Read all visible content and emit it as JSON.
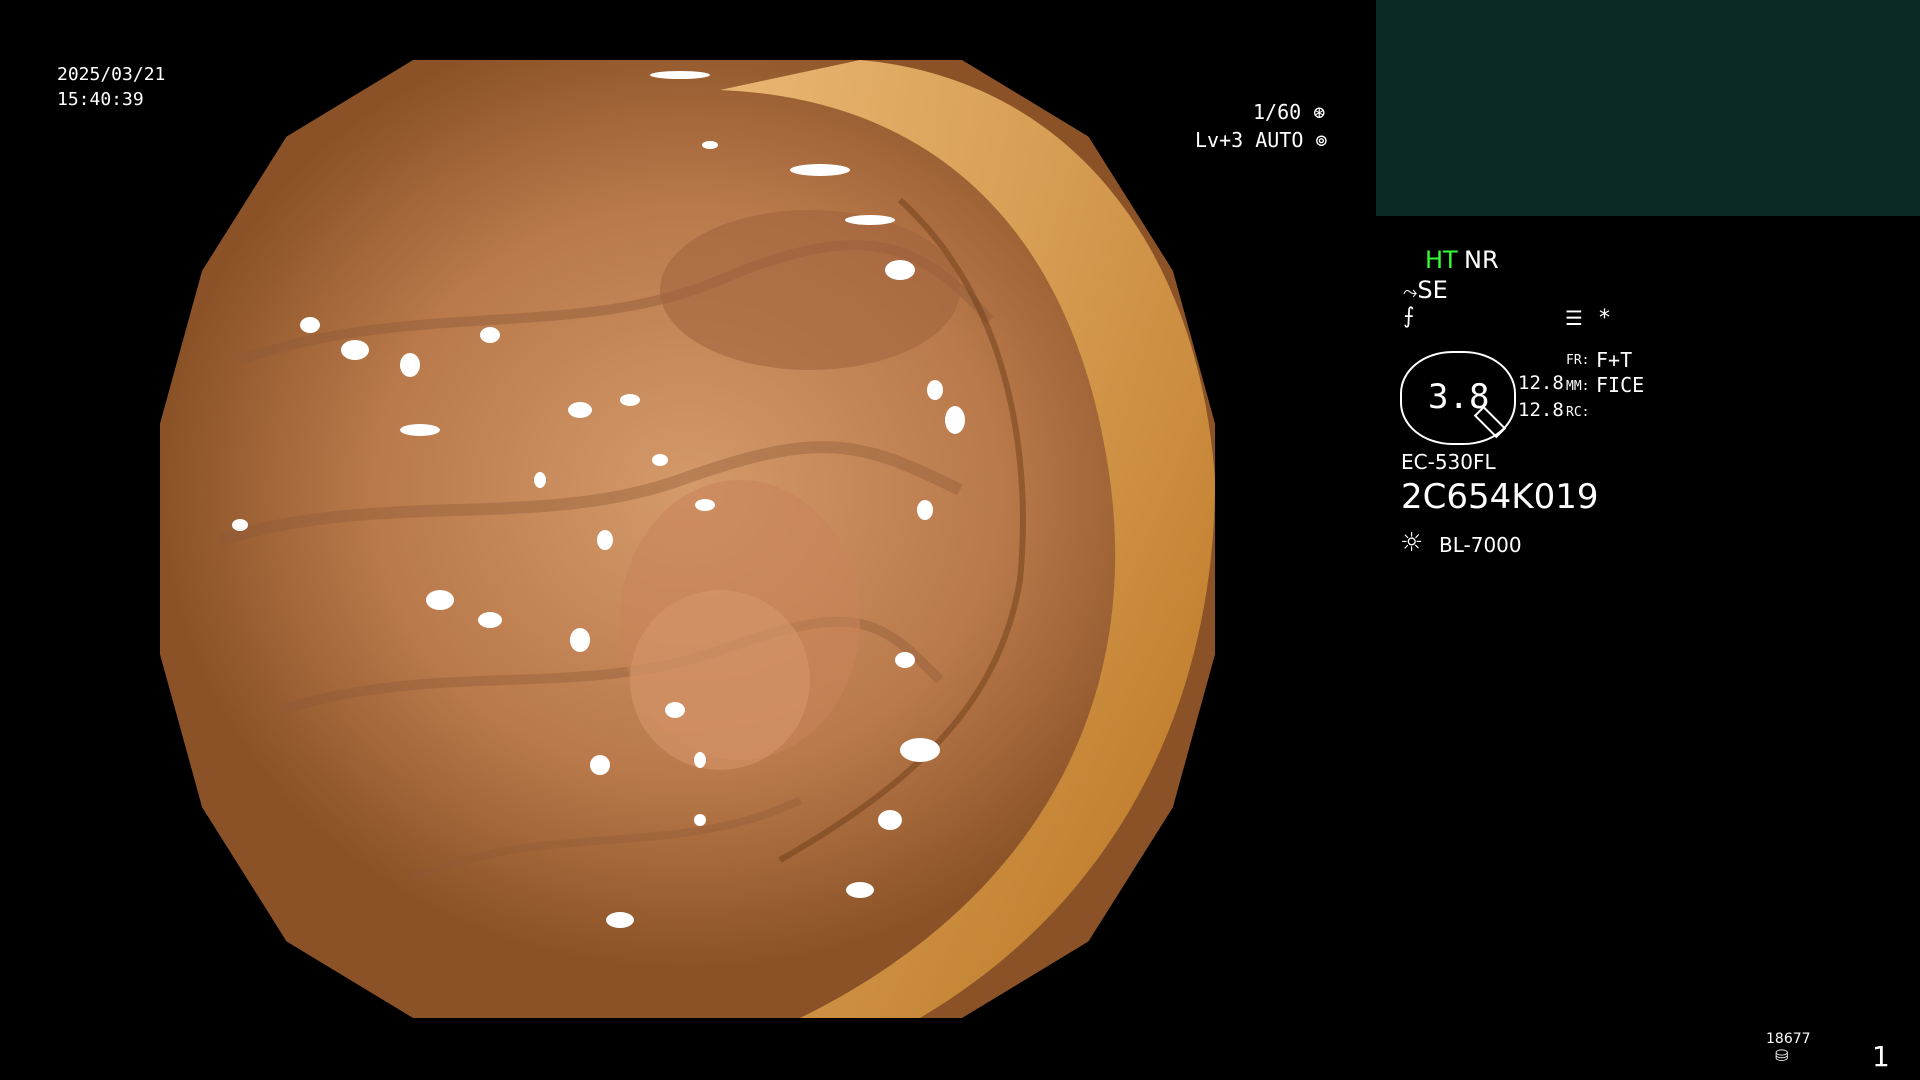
{
  "header": {
    "date": "2025/03/21",
    "time": "15:40:39",
    "shutter": "1/60",
    "level": "Lv+3 AUTO",
    "shutter_icon": "aperture-icon",
    "auto_icon": "iris-icon"
  },
  "status": {
    "ht": "HT",
    "nr": "NR",
    "se": "SE",
    "ht_color": "#33ff33"
  },
  "gauge": {
    "value": "3.8",
    "val1": "12.8",
    "val2": "12.8",
    "fr_label": "FR:",
    "fr_value": "F+T",
    "mm_label": "MM:",
    "mm_value": "FICE",
    "rc_label": "RC:"
  },
  "device": {
    "model": "EC-530FL",
    "serial": "2C654K019",
    "light_source": "BL-7000"
  },
  "footer": {
    "counter": "18677",
    "page": "1"
  },
  "colors": {
    "background": "#000000",
    "inset_panel": "#0b2a26",
    "mucosa": "#b8774a"
  }
}
